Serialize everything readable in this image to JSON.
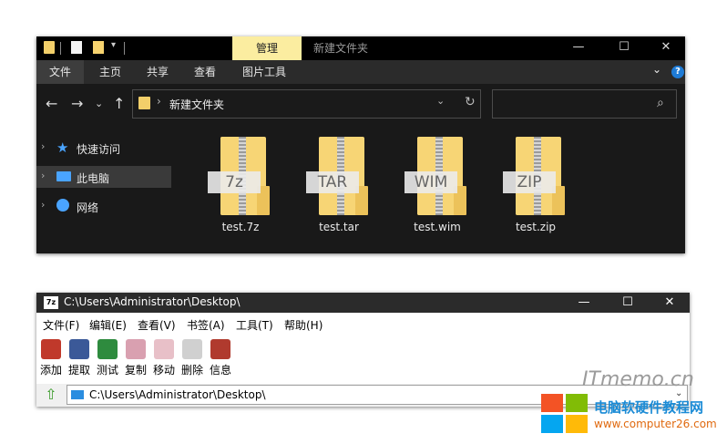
{
  "explorer": {
    "context_tab": "管理",
    "window_title": "新建文件夹",
    "window_controls": {
      "minimize": "—",
      "maximize": "☐",
      "close": "✕"
    },
    "ribbon_tabs": [
      "文件",
      "主页",
      "共享",
      "查看",
      "图片工具"
    ],
    "ribbon_help": "?",
    "address": {
      "path": "新建文件夹",
      "separator": "›"
    },
    "nav_pane": [
      {
        "label": "快速访问",
        "icon": "star-icon"
      },
      {
        "label": "此电脑",
        "icon": "computer-icon"
      },
      {
        "label": "网络",
        "icon": "network-icon"
      }
    ],
    "files": [
      {
        "name": "test.7z",
        "badge": "7z"
      },
      {
        "name": "test.tar",
        "badge": "TAR"
      },
      {
        "name": "test.wim",
        "badge": "WIM"
      },
      {
        "name": "test.zip",
        "badge": "ZIP"
      }
    ]
  },
  "sevenzip": {
    "logo": "7z",
    "title": "C:\\Users\\Administrator\\Desktop\\",
    "window_controls": {
      "minimize": "—",
      "maximize": "☐",
      "close": "✕"
    },
    "menu": [
      "文件(F)",
      "编辑(E)",
      "查看(V)",
      "书签(A)",
      "工具(T)",
      "帮助(H)"
    ],
    "toolbar": [
      {
        "label": "添加",
        "color": "#c0392b"
      },
      {
        "label": "提取",
        "color": "#3b5998"
      },
      {
        "label": "测试",
        "color": "#2e8b3e"
      },
      {
        "label": "复制",
        "color": "#d9a0b0"
      },
      {
        "label": "移动",
        "color": "#e8c0c8"
      },
      {
        "label": "删除",
        "color": "#d0d0d0"
      },
      {
        "label": "信息",
        "color": "#b03a2e"
      }
    ],
    "address_path": "C:\\Users\\Administrator\\Desktop\\"
  },
  "watermark": {
    "brand": "ITmemo.cn",
    "site_name": "电脑软硬件教程网",
    "url": "www.computer26.com"
  }
}
